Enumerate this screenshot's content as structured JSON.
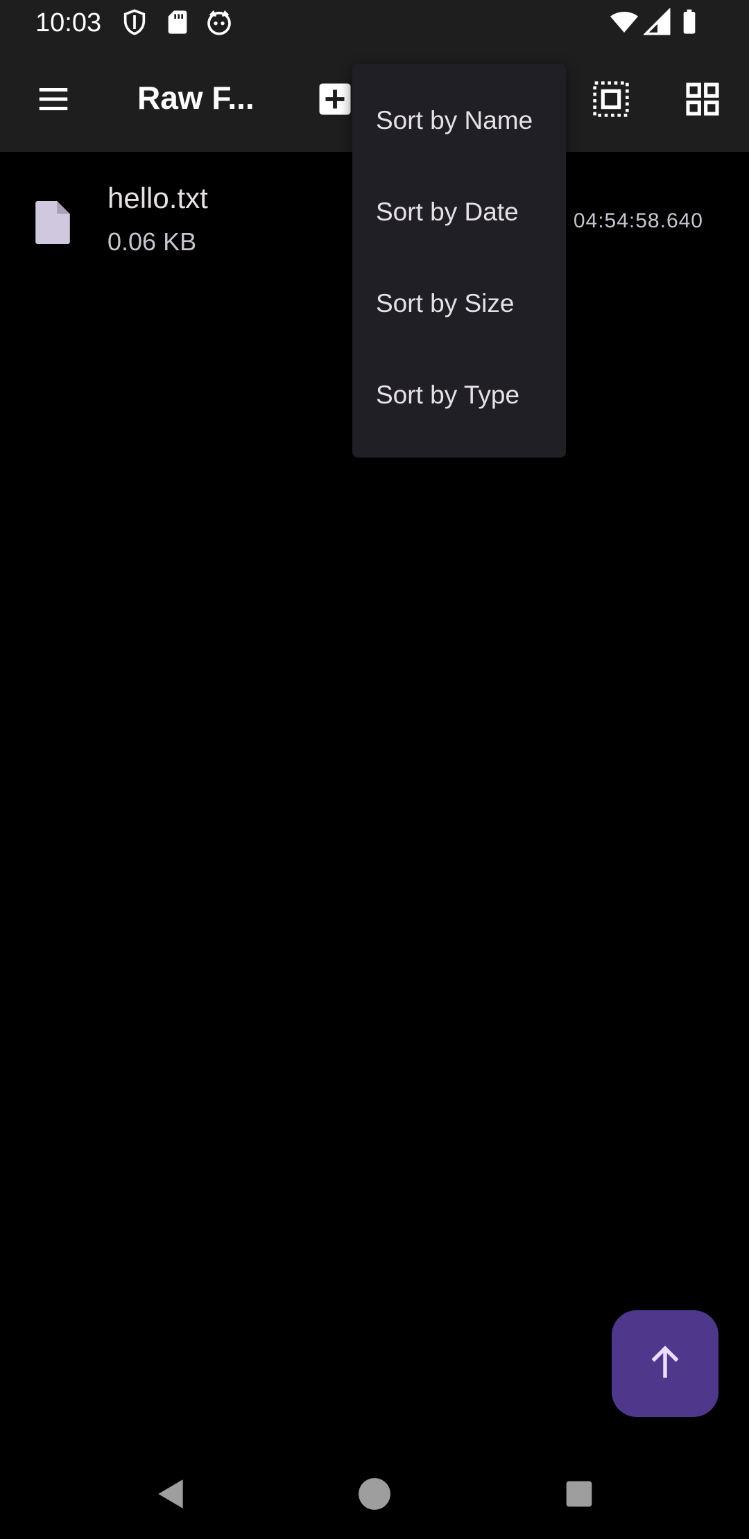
{
  "status_bar": {
    "time": "10:03",
    "left_icons": [
      "shield-icon",
      "sd-card-icon",
      "cat-face-icon"
    ],
    "right_icons": [
      "wifi-icon",
      "cell-signal-icon",
      "battery-icon"
    ]
  },
  "app_bar": {
    "title": "Raw F...",
    "icons": [
      "menu-icon",
      "add-icon",
      "select-all-icon",
      "grid-view-icon"
    ]
  },
  "files": [
    {
      "name": "hello.txt",
      "size": "0.06 KB",
      "date": "04:54:58.640",
      "icon": "file-icon"
    }
  ],
  "sort_menu": {
    "items": [
      "Sort by Name",
      "Sort by Date",
      "Sort by Size",
      "Sort by Type"
    ]
  },
  "fab": {
    "icon": "arrow-up-icon"
  },
  "nav_bar": {
    "icons": [
      "back-icon",
      "home-icon",
      "recents-icon"
    ]
  },
  "colors": {
    "background": "#000000",
    "bar": "#1e1e1e",
    "menu": "#211f26",
    "fab": "#4f378b",
    "fab_icon": "#eaddff"
  }
}
